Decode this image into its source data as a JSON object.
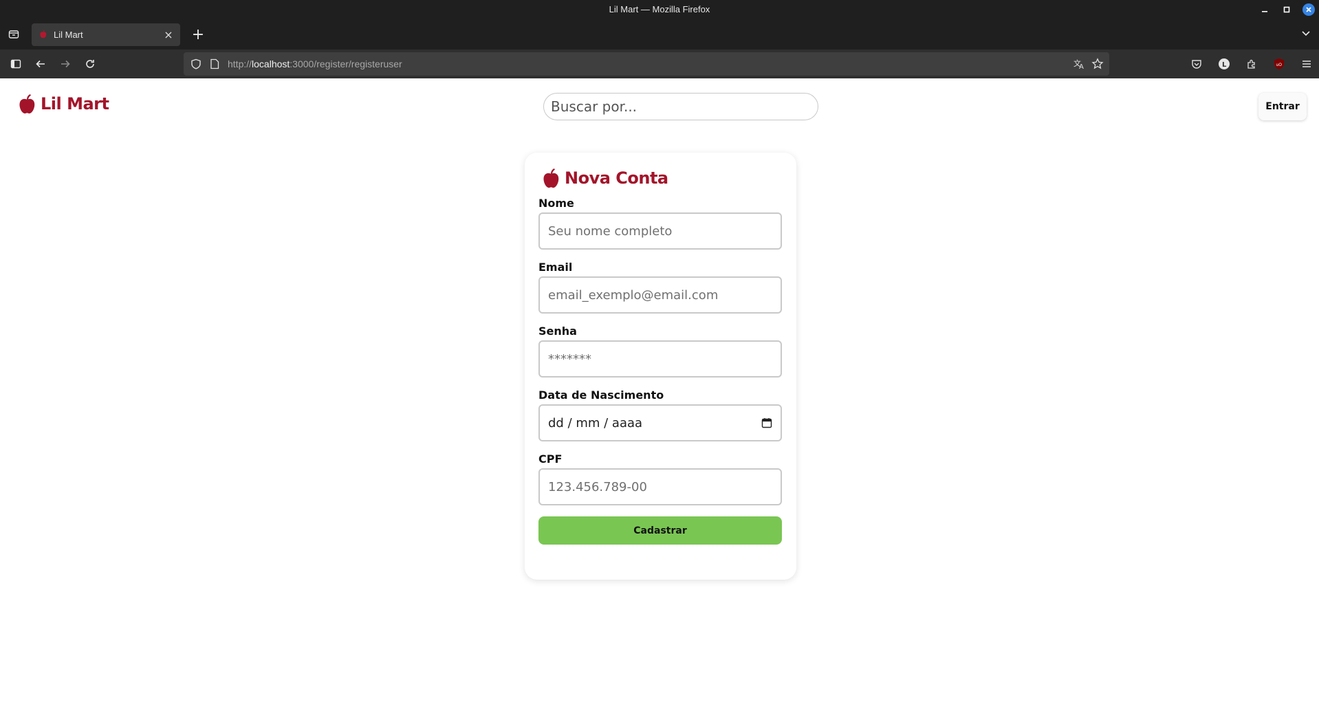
{
  "window": {
    "title": "Lil Mart — Mozilla Firefox"
  },
  "tab": {
    "title": "Lil Mart"
  },
  "urlbar": {
    "url_prefix": "http://",
    "url_host": "localhost",
    "url_rest": ":3000/register/registeruser"
  },
  "header": {
    "logo_text": "Lil Mart",
    "search_placeholder": "Buscar por...",
    "login_label": "Entrar"
  },
  "form": {
    "title": "Nova Conta",
    "fields": [
      {
        "label": "Nome",
        "placeholder": "Seu nome completo"
      },
      {
        "label": "Email",
        "placeholder": "email_exemplo@email.com"
      },
      {
        "label": "Senha",
        "placeholder": "*******"
      },
      {
        "label": "Data de Nascimento",
        "placeholder": "dd / mm / aaaa"
      },
      {
        "label": "CPF",
        "placeholder": "123.456.789-00"
      }
    ],
    "submit_label": "Cadastrar"
  },
  "colors": {
    "brand": "#a3142a",
    "submit": "#7ac653"
  },
  "icons": [
    "apple-icon",
    "calendar-icon",
    "shield-icon",
    "star-icon",
    "translate-icon"
  ]
}
